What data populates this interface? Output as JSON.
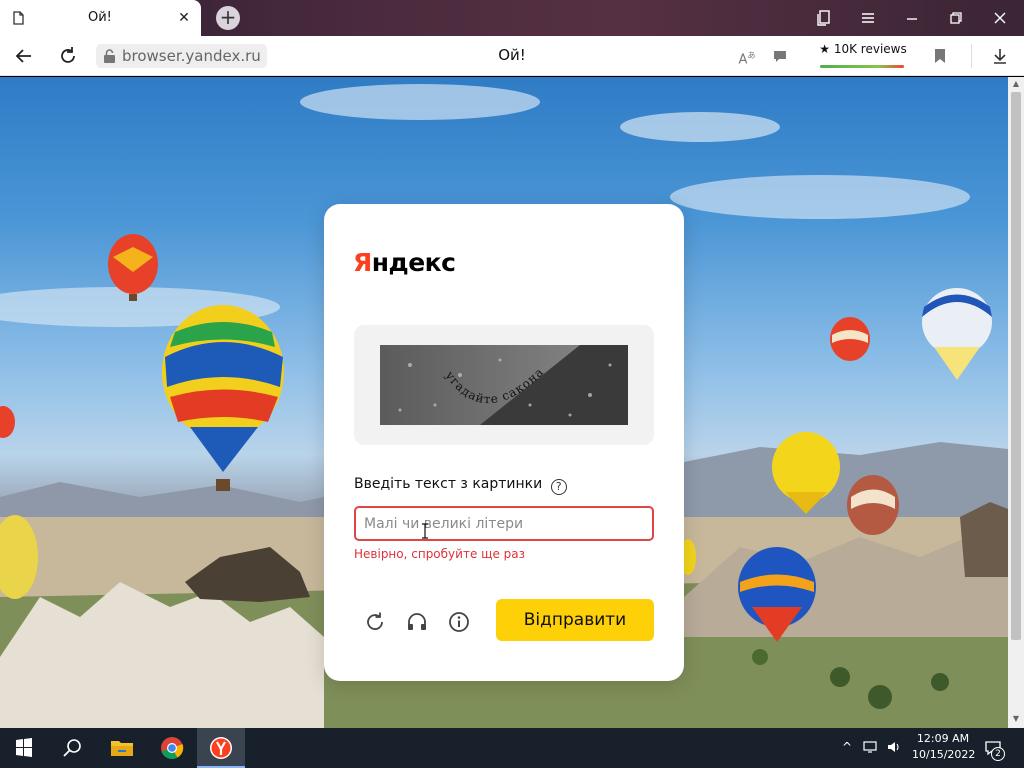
{
  "browser": {
    "tab": {
      "title": "Ой!",
      "close_icon": "close-icon",
      "doc_icon": "document-icon"
    },
    "new_tab_icon": "plus-icon",
    "window_controls": [
      "bookmarks-panel-icon",
      "menu-icon",
      "minimize-icon",
      "restore-icon",
      "close-icon"
    ],
    "address": {
      "url": "browser.yandex.ru",
      "page_title": "Ой!"
    },
    "toolbar": {
      "reviews_label": "10K reviews",
      "reviews_icon": "star-icon"
    }
  },
  "captcha": {
    "logo_first": "Я",
    "logo_rest": "ндекс",
    "prompt_label": "Введіть текст з картинки",
    "help_symbol": "?",
    "input_placeholder": "Малі чи великі літери",
    "input_value": "",
    "error_message": "Невірно, спробуйте ще раз",
    "submit_label": "Відправити",
    "captcha_text": "угадайте сакона",
    "tools": [
      "refresh-icon",
      "audio-headphones-icon",
      "info-icon"
    ]
  },
  "taskbar": {
    "apps": [
      "windows-start-icon",
      "search-icon",
      "file-explorer-icon",
      "chrome-icon",
      "yandex-browser-icon"
    ],
    "clock_time": "12:09 AM",
    "clock_date": "10/15/2022",
    "notification_count": "2"
  },
  "colors": {
    "brand_red": "#fc3f1d",
    "submit_yellow": "#fdd007",
    "error_red": "#e0323a"
  }
}
